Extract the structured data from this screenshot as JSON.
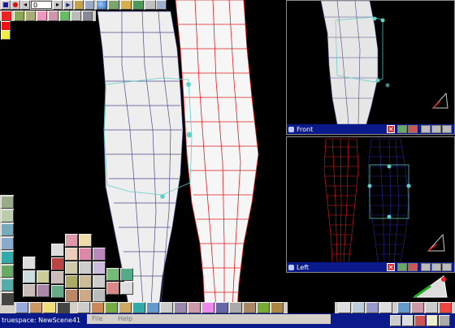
{
  "toolbar": {
    "frame_value": "0",
    "frame_prev": "◂",
    "frame_next": "▸",
    "record": "●",
    "play": "▶"
  },
  "viewports": {
    "front": {
      "label": "Front",
      "close": "✕"
    },
    "left": {
      "label": "Left",
      "close": "✕"
    }
  },
  "taskbar": {
    "app_title": "truespace: NewScene41"
  },
  "menu": {
    "items": [
      "File",
      "Help"
    ]
  },
  "colors": {
    "viewport_title_bg": "#0a1a8a",
    "red_mesh": "#e21c1c",
    "blue_mesh": "#2a2a9a",
    "selection_cyan": "#5fd0c8",
    "close_red": "#d33333"
  },
  "icons": {
    "render": "sphere-icon",
    "move": "arrows-icon",
    "rotate": "rotate-icon",
    "scale": "scale-icon"
  }
}
